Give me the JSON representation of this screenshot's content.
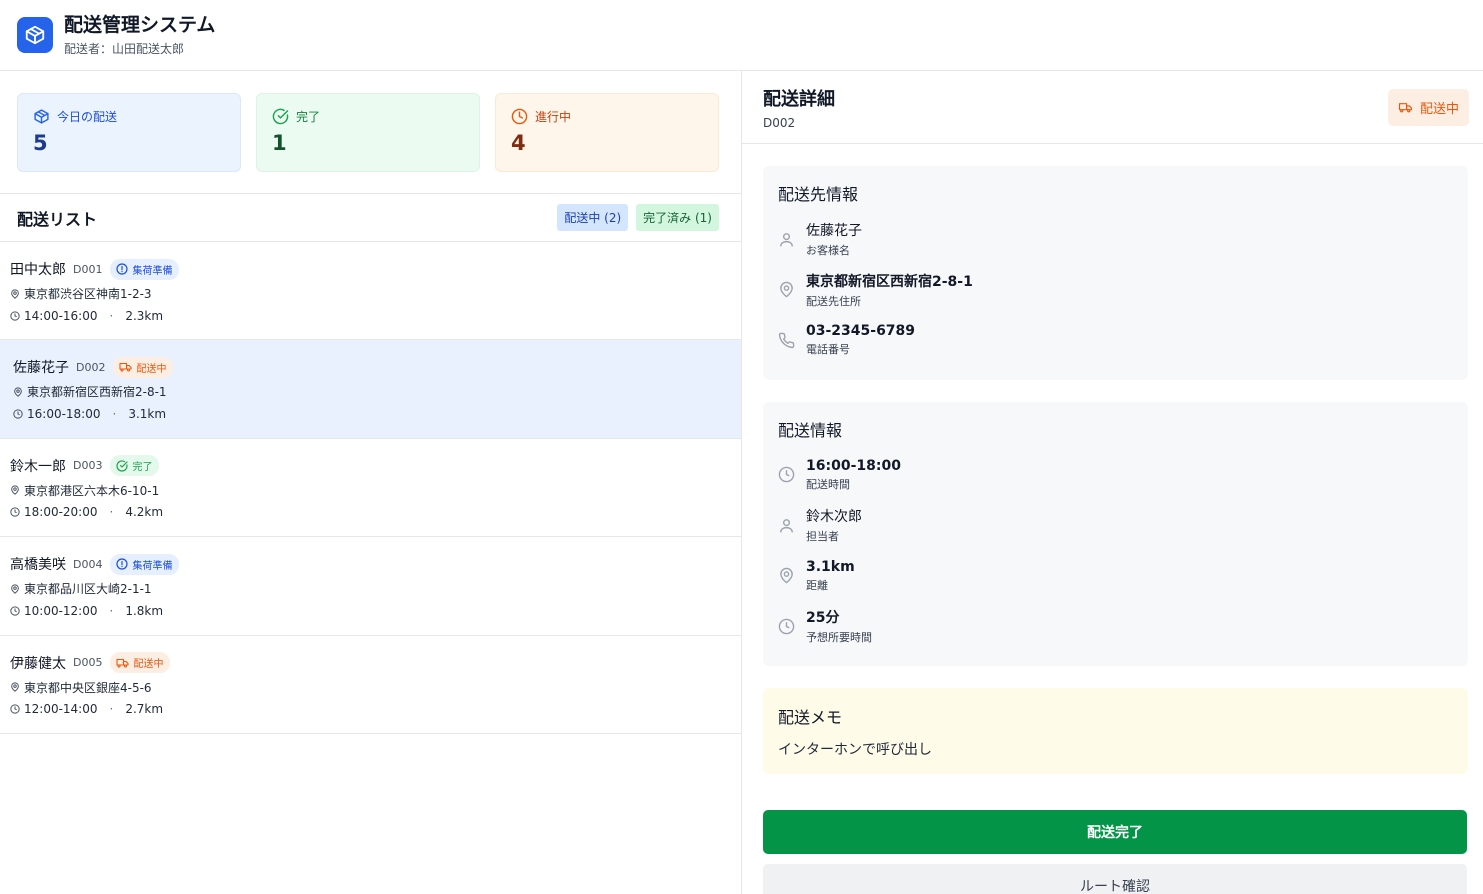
{
  "app": {
    "title": "配送管理システム",
    "driver": "配送者：山田配送太郎"
  },
  "stats": [
    {
      "label": "今日の配送",
      "value": "5"
    },
    {
      "label": "完了",
      "value": "1"
    },
    {
      "label": "進行中",
      "value": "4"
    }
  ],
  "list": {
    "title": "配送リスト",
    "filters": {
      "shipping": "配送中 (2)",
      "done": "完了済み (1)"
    },
    "rows": [
      {
        "name": "田中太郎",
        "id": "D001",
        "status": "集荷準備",
        "address": "東京都渋谷区神南1-2-3",
        "time": "14:00-16:00",
        "distance": "2.3km"
      },
      {
        "name": "佐藤花子",
        "id": "D002",
        "status": "配送中",
        "address": "東京都新宿区西新宿2-8-1",
        "time": "16:00-18:00",
        "distance": "3.1km"
      },
      {
        "name": "鈴木一郎",
        "id": "D003",
        "status": "完了",
        "address": "東京都港区六本木6-10-1",
        "time": "18:00-20:00",
        "distance": "4.2km"
      },
      {
        "name": "高橋美咲",
        "id": "D004",
        "status": "集荷準備",
        "address": "東京都品川区大崎2-1-1",
        "time": "10:00-12:00",
        "distance": "1.8km"
      },
      {
        "name": "伊藤健太",
        "id": "D005",
        "status": "配送中",
        "address": "東京都中央区銀座4-5-6",
        "time": "12:00-14:00",
        "distance": "2.7km"
      }
    ]
  },
  "detail": {
    "title": "配送詳細",
    "id": "D002",
    "status": "配送中",
    "recipient": {
      "title": "配送先情報",
      "name": "佐藤花子",
      "name_label": "お客様名",
      "address": "東京都新宿区西新宿2-8-1",
      "address_label": "配送先住所",
      "phone": "03-2345-6789",
      "phone_label": "電話番号"
    },
    "delivery": {
      "title": "配送情報",
      "time": "16:00-18:00",
      "time_label": "配送時間",
      "staff": "鈴木次郎",
      "staff_label": "担当者",
      "distance": "3.1km",
      "distance_label": "距離",
      "eta": "25分",
      "eta_label": "予想所要時間"
    },
    "memo": {
      "title": "配送メモ",
      "text": "インターホンで呼び出し"
    },
    "buttons": {
      "complete": "配送完了",
      "route": "ルート確認"
    }
  }
}
